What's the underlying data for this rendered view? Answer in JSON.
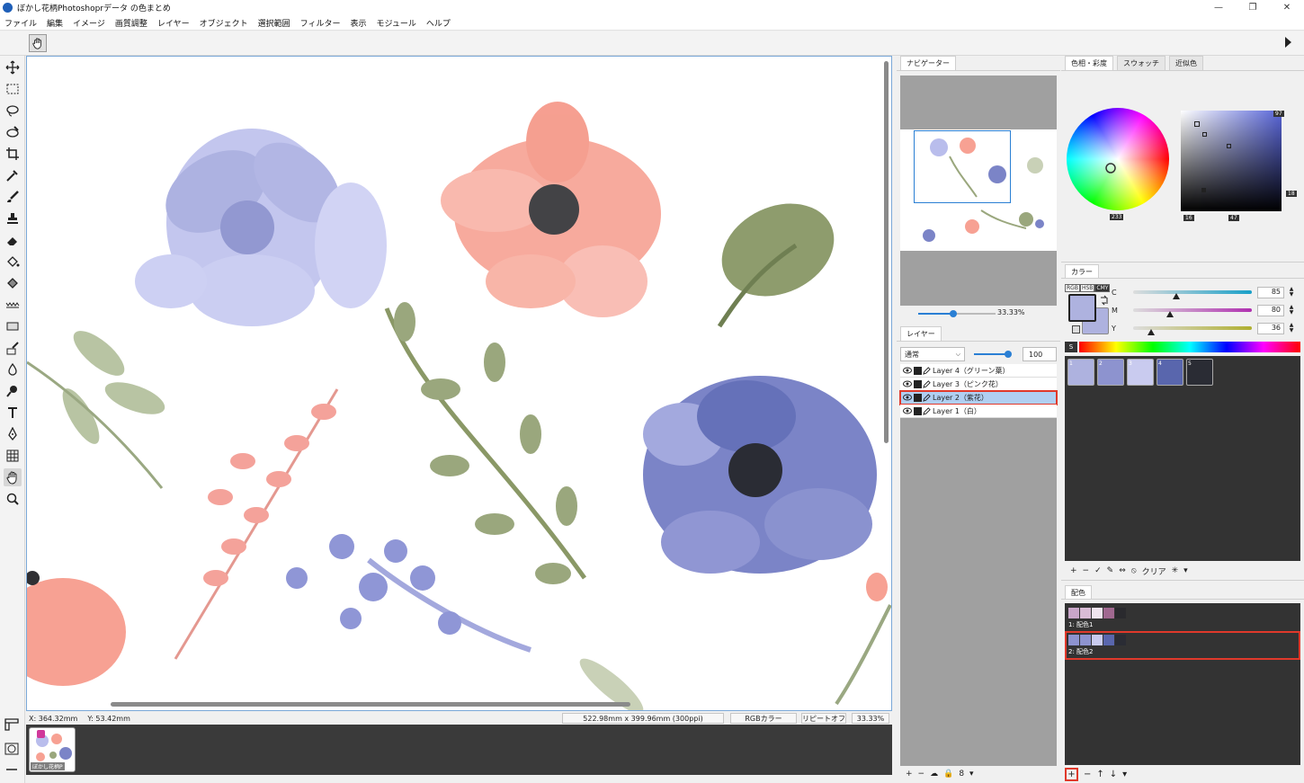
{
  "window": {
    "title": "ぼかし花柄Photoshoprデータ の色まとめ",
    "buttons": [
      "—",
      "❐",
      "✕"
    ]
  },
  "menu": [
    "ファイル",
    "編集",
    "イメージ",
    "画質調整",
    "レイヤー",
    "オブジェクト",
    "選択範囲",
    "フィルター",
    "表示",
    "モジュール",
    "ヘルプ"
  ],
  "status": {
    "x_label": "X:",
    "x_value": "364.32mm",
    "y_label": "Y:",
    "y_value": "53.42mm",
    "size": "522.98mm x 399.96mm (300ppi)",
    "color_mode": "RGBカラー",
    "repeat": "リピートオフ",
    "zoom": "33.33%"
  },
  "document_tab": {
    "label": "ぼかし花柄P"
  },
  "navigator": {
    "tab": "ナビゲーター",
    "zoom": "33.33%",
    "zoom_fraction": 0.45
  },
  "layers": {
    "tab": "レイヤー",
    "blend_mode": "通常",
    "opacity": "100",
    "items": [
      {
        "name": "Layer 4（グリーン葉）",
        "selected": false
      },
      {
        "name": "Layer 3（ピンク花）",
        "selected": false
      },
      {
        "name": "Layer 2（紫花）",
        "selected": true
      },
      {
        "name": "Layer 1（白）",
        "selected": false
      }
    ],
    "footer_tools": [
      "+",
      "−",
      "☁",
      "🔒",
      "8",
      "▾"
    ]
  },
  "color_tabs": [
    "色相・彩度",
    "スウォッチ",
    "近似色"
  ],
  "hue_wheel": {
    "hue": "233",
    "sat": "16",
    "val": "47",
    "top_right": "97",
    "right": "18"
  },
  "color_panel": {
    "title": "カラー",
    "modes": [
      "RGB",
      "HSB",
      "CMY"
    ],
    "active_mode": "CMY",
    "fg_color": "#aeb2df",
    "sliders": [
      {
        "label": "C",
        "value": "85",
        "fraction": 0.36
      },
      {
        "label": "M",
        "value": "80",
        "fraction": 0.31
      },
      {
        "label": "Y",
        "value": "36",
        "fraction": 0.15
      }
    ],
    "spectrum_label": "S"
  },
  "swatches": {
    "items": [
      {
        "label": "1",
        "color": "#aeb2df"
      },
      {
        "label": "2",
        "color": "#8d93cf"
      },
      {
        "label": "3",
        "color": "#c9cbef"
      },
      {
        "label": "4",
        "color": "#5966ad"
      },
      {
        "label": "5",
        "color": "#2a2c34"
      }
    ],
    "tools": [
      "+",
      "−",
      "✓",
      "✎",
      "⇔",
      "⦸",
      "クリア",
      "✳",
      "▾"
    ]
  },
  "haishoku": {
    "title": "配色",
    "items": [
      {
        "label": "1: 配色1",
        "colors": [
          "#c9a6c9",
          "#d9bcd6",
          "#efe4ee",
          "#a06890",
          "#2a2a2e"
        ],
        "selected": false
      },
      {
        "label": "2: 配色2",
        "colors": [
          "#8d93cf",
          "#8d93cf",
          "#c9cbef",
          "#5966ad",
          "#2a2c34"
        ],
        "selected": true
      }
    ],
    "footer_tools": [
      "+",
      "−",
      "↑",
      "↓",
      "▾"
    ]
  }
}
